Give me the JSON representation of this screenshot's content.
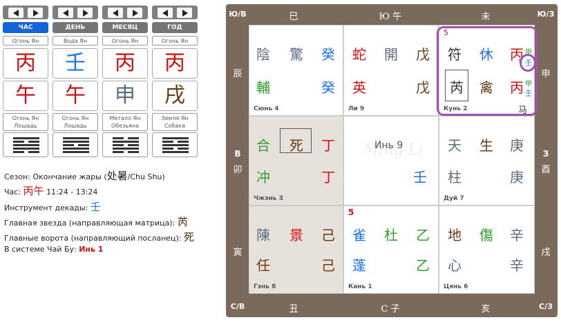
{
  "nav": {
    "tabs": [
      "ЧАС",
      "ДЕНЬ",
      "МЕСЯЦ",
      "ГОД"
    ]
  },
  "pillars": [
    {
      "stem_element": "Огонь Ян",
      "stem": "丙",
      "branch": "午",
      "branch_element": "Огонь Ян",
      "animal": "Лошадь"
    },
    {
      "stem_element": "Вода Ян",
      "stem": "壬",
      "branch": "午",
      "branch_element": "Огонь Ян",
      "animal": "Лошадь"
    },
    {
      "stem_element": "Огонь Ян",
      "stem": "丙",
      "branch": "申",
      "branch_element": "Металл Ян",
      "animal": "Обезьяна"
    },
    {
      "stem_element": "Огонь Ян",
      "stem": "丙",
      "branch": "戌",
      "branch_element": "Земля Ян",
      "animal": "Собака"
    }
  ],
  "info": {
    "season_label": "Сезон:",
    "season_value": "Окончание жары (",
    "season_hanzi": "处暑",
    "season_tail": "/Chu Shu)",
    "hour_label": "Час:",
    "hour_hanzi": "丙午",
    "hour_time": "11:24 - 13:24",
    "decade_label": "Инструмент декады:",
    "decade_value": "壬",
    "star_label": "Главная звезда (направляющая матрица):",
    "star_value": "芮",
    "gate_label": "Главные ворота (направляющий посланец):",
    "gate_value": "死",
    "system_label": "В системе Чай Бу:",
    "system_value": "Инь 1"
  },
  "frame": {
    "nw": "Ю/В",
    "ne": "Ю/З",
    "sw": "С/В",
    "se": "С/З",
    "top": [
      "巳",
      "Ю 午",
      "未"
    ],
    "bottom": [
      "丑",
      "С 子",
      "亥"
    ],
    "left_top": "辰",
    "left_mid_dir": "В",
    "left_mid": "卯",
    "left_bot": "寅",
    "right_top": "申",
    "right_mid_dir": "З",
    "right_mid": "酉",
    "right_bot": "戌"
  },
  "palaces": {
    "xun4": {
      "label": "Сюнь 4",
      "r1": [
        "陰",
        "驚",
        "癸"
      ],
      "r2": [
        "輔",
        "癸"
      ]
    },
    "li9": {
      "label": "Ли 9",
      "r1": [
        "蛇",
        "開",
        "戊"
      ],
      "r2": [
        "英",
        "戊"
      ]
    },
    "kun2": {
      "label": "Кунь 2",
      "num": "5",
      "r1": [
        "符",
        "休",
        "丙"
      ],
      "r2": [
        "芮",
        "禽",
        "丙"
      ],
      "small1": "甲",
      "small2": "壬",
      "small3": "甲",
      "small4": "壬",
      "horse": "马"
    },
    "zhen3": {
      "label": "Чжэнь 3",
      "r1": [
        "合",
        "死",
        "丁"
      ],
      "r2": [
        "冲",
        "丁"
      ]
    },
    "center": {
      "title": "Инь 9",
      "stem": "壬",
      "watermark": "Ming Li"
    },
    "dui7": {
      "label": "Дуй 7",
      "r1": [
        "天",
        "生",
        "庚"
      ],
      "r2": [
        "柱",
        "庚"
      ]
    },
    "gen8": {
      "label": "Гэнь 8",
      "r1": [
        "陳",
        "景",
        "己"
      ],
      "r2": [
        "任",
        "己"
      ]
    },
    "kan1": {
      "label": "Кань 1",
      "num": "5",
      "r1": [
        "雀",
        "杜",
        "乙"
      ],
      "r2": [
        "蓬",
        "乙"
      ]
    },
    "qian6": {
      "label": "Цянь 6",
      "r1": [
        "地",
        "傷",
        "辛"
      ],
      "r2": [
        "心",
        "辛"
      ]
    }
  }
}
